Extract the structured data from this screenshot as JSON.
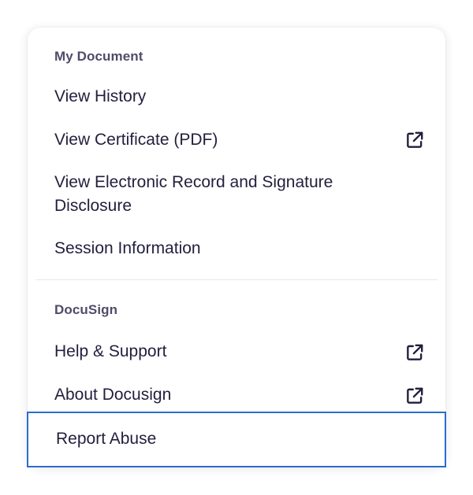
{
  "menu": {
    "sections": [
      {
        "header": "My Document",
        "items": [
          {
            "label": "View History"
          },
          {
            "label": "View Certificate (PDF)",
            "icon": "external-link-icon"
          },
          {
            "label": "View Electronic Record and Signature Disclosure"
          },
          {
            "label": "Session Information"
          }
        ]
      },
      {
        "header": "DocuSign",
        "items": [
          {
            "label": "Help & Support",
            "icon": "external-link-icon"
          },
          {
            "label": "About Docusign",
            "icon": "external-link-icon"
          },
          {
            "label": "Report Abuse",
            "focused": true
          }
        ]
      }
    ]
  },
  "colors": {
    "text": "#211f3c",
    "section_header": "#4f4c68",
    "focus_ring": "#2b6bd6",
    "divider": "#e7e6ec"
  }
}
